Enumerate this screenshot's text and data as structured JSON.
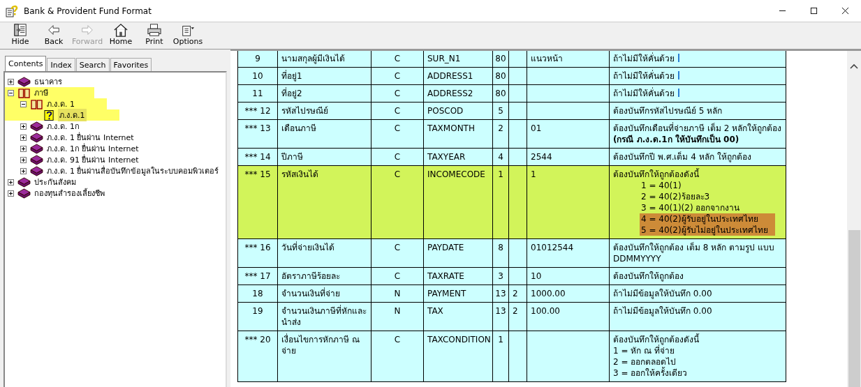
{
  "window": {
    "title": "Bank & Provident Fund Format"
  },
  "toolbar": [
    {
      "label": "Hide",
      "kind": "hide",
      "disabled": false
    },
    {
      "label": "Back",
      "kind": "back",
      "disabled": false
    },
    {
      "label": "Forward",
      "kind": "forward",
      "disabled": true
    },
    {
      "label": "Home",
      "kind": "home",
      "disabled": false
    },
    {
      "label": "Print",
      "kind": "print",
      "disabled": false
    },
    {
      "label": "Options",
      "kind": "options",
      "disabled": false
    }
  ],
  "tabs": [
    {
      "label": "Contents",
      "selected": true
    },
    {
      "label": "Index",
      "selected": false
    },
    {
      "label": "Search",
      "selected": false
    },
    {
      "label": "Favorites",
      "selected": false
    }
  ],
  "tree": [
    {
      "label": "ธนาคาร",
      "kind": "book",
      "expanded": false,
      "selected": false,
      "highlighted": false
    },
    {
      "label": "ภาษี",
      "kind": "book",
      "expanded": true,
      "selected": false,
      "highlighted": true,
      "children": [
        {
          "label": "ภ.ง.ด. 1",
          "kind": "book",
          "expanded": true,
          "selected": false,
          "highlighted": true,
          "children": [
            {
              "label": "ภ.ง.ด.1",
              "kind": "topic",
              "selected": true,
              "highlighted": true
            }
          ]
        },
        {
          "label": "ภ.ง.ด. 1ก",
          "kind": "book",
          "expanded": false,
          "selected": false,
          "highlighted": false
        },
        {
          "label": "ภ.ง.ด. 1 ยื่นผ่าน Internet",
          "kind": "book",
          "expanded": false,
          "selected": false,
          "highlighted": false
        },
        {
          "label": "ภ.ง.ด. 1ก ยื่นผ่าน Internet",
          "kind": "book",
          "expanded": false,
          "selected": false,
          "highlighted": false
        },
        {
          "label": "ภ.ง.ด. 91 ยื่นผ่าน Internet",
          "kind": "book",
          "expanded": false,
          "selected": false,
          "highlighted": false
        },
        {
          "label": "ภ.ง.ด. 1 ยื่นผ่านสื่อบันทึกข้อมูลในระบบคอมพิวเตอร์",
          "kind": "book",
          "expanded": false,
          "selected": false,
          "highlighted": false
        }
      ]
    },
    {
      "label": "ประกันสังคม",
      "kind": "book",
      "expanded": false,
      "selected": false,
      "highlighted": false
    },
    {
      "label": "กองทุนสำรองเลี้ยงชีพ",
      "kind": "book",
      "expanded": false,
      "selected": false,
      "highlighted": false
    }
  ],
  "table": {
    "rows": [
      {
        "number": "9",
        "name": "นามสกุลผู้มีเงินได้",
        "type": "C",
        "field": "SUR_N1",
        "length": "80",
        "decimals": "",
        "example": "แนวหน้า",
        "highlighted": false,
        "note": [
          {
            "text": "ถ้าไม่มีให้คั่นด้วย",
            "kind": "pipe"
          }
        ]
      },
      {
        "number": "10",
        "name": "ที่อยู่1",
        "type": "C",
        "field": "ADDRESS1",
        "length": "80",
        "decimals": "",
        "example": "",
        "highlighted": false,
        "note": [
          {
            "text": "ถ้าไม่มีให้คั่นด้วย",
            "kind": "pipe"
          }
        ]
      },
      {
        "number": "11",
        "name": "ที่อยู่2",
        "type": "C",
        "field": "ADDRESS2",
        "length": "80",
        "decimals": "",
        "example": "",
        "highlighted": false,
        "note": [
          {
            "text": "ถ้าไม่มีให้คั่นด้วย",
            "kind": "pipe"
          }
        ]
      },
      {
        "number": "*** 12",
        "name": "รหัสไปรษณีย์",
        "type": "C",
        "field": "POSCOD",
        "length": "5",
        "decimals": "",
        "example": "",
        "highlighted": false,
        "note": [
          {
            "text": "ต้องบันทึกรหัสไปรษณีย์ 5 หลัก",
            "kind": "plain"
          }
        ]
      },
      {
        "number": "*** 13",
        "name": "เดือนภาษี",
        "type": "C",
        "field": "TAXMONTH",
        "length": "2",
        "decimals": "",
        "example": "01",
        "highlighted": false,
        "note": [
          {
            "text": "ต้องบันทึกเดือนที่จ่ายภาษี เต็ม 2 หลักให้ถูกต้อง",
            "kind": "plain"
          },
          {
            "text": "(กรณี ภ.ง.ด.1ก ให้บันทึกเป็น  00)",
            "kind": "bold"
          }
        ]
      },
      {
        "number": "*** 14",
        "name": "ปีภาษี",
        "type": "C",
        "field": "TAXYEAR",
        "length": "4",
        "decimals": "",
        "example": "2544",
        "highlighted": false,
        "note": [
          {
            "text": "ต้องบันทึกปี พ.ศ.เต็ม 4 หลัก ให้ถูกต้อง",
            "kind": "plain"
          }
        ]
      },
      {
        "number": "*** 15",
        "name": "รหัสเงินได้",
        "type": "C",
        "field": "INCOMECODE",
        "length": "1",
        "decimals": "",
        "example": "1",
        "highlighted": true,
        "note": [
          {
            "text": "ต้องบันทึกให้ถูกต้องดังนี้",
            "kind": "plain"
          },
          {
            "text": "1 = 40(1)",
            "kind": "indented"
          },
          {
            "text": "2 = 40(2)ร้อยละ3",
            "kind": "indented"
          },
          {
            "text": "3 = 40(1)(2) ออกจากงาน",
            "kind": "indented"
          },
          {
            "text": "4 = 40(2)ผู้รับอยู่ในประเทศไทย",
            "kind": "marked"
          },
          {
            "text": "5 = 40(2)ผู้รับไม่อยู่ในประเทศไทย",
            "kind": "marked"
          }
        ]
      },
      {
        "number": "*** 16",
        "name": "วันที่จ่ายเงินได้",
        "type": "C",
        "field": "PAYDATE",
        "length": "8",
        "decimals": "",
        "example": "01012544",
        "highlighted": false,
        "note": [
          {
            "text": "ต้องบันทึกให้ถูกต้อง เต็ม 8 หลัก ตามรูป  แบบ DDMMYYYY",
            "kind": "plain"
          }
        ]
      },
      {
        "number": "*** 17",
        "name": "อัตราภาษีร้อยละ",
        "type": "C",
        "field": "TAXRATE",
        "length": "3",
        "decimals": "",
        "example": "10",
        "highlighted": false,
        "note": [
          {
            "text": "ต้องบันทึกให้ถูกต้อง",
            "kind": "plain"
          }
        ]
      },
      {
        "number": "18",
        "name": "จำนวนเงินที่จ่าย",
        "type": "N",
        "field": "PAYMENT",
        "length": "13",
        "decimals": "2",
        "example": "1000.00",
        "highlighted": false,
        "note": [
          {
            "text": "ถ้าไม่มีข้อมูลให้บันทึก 0.00",
            "kind": "plain"
          }
        ]
      },
      {
        "number": "19",
        "name": "จำนวนเงินภาษีที่หักและนำส่ง",
        "type": "N",
        "field": "TAX",
        "length": "13",
        "decimals": "2",
        "example": "100.00",
        "highlighted": false,
        "note": [
          {
            "text": "ถ้าไม่มีข้อมูลให้บันทึก 0.00",
            "kind": "plain"
          }
        ]
      },
      {
        "number": "*** 20",
        "name": "เงื่อนไขการหักภาษี ณ จ่าย",
        "type": "C",
        "field": "TAXCONDITION",
        "length": "1",
        "decimals": "",
        "example": "",
        "highlighted": false,
        "note": [
          {
            "text": "ต้องบันทึกให้ถูกต้องดังนี้",
            "kind": "plain"
          },
          {
            "text": "1 = หัก ณ ที่จ่าย",
            "kind": "plain"
          },
          {
            "text": "2 = ออกตลอดไป",
            "kind": "plain"
          },
          {
            "text": "3 = ออกให้ครั้งเดียว",
            "kind": "plain"
          }
        ]
      }
    ]
  }
}
